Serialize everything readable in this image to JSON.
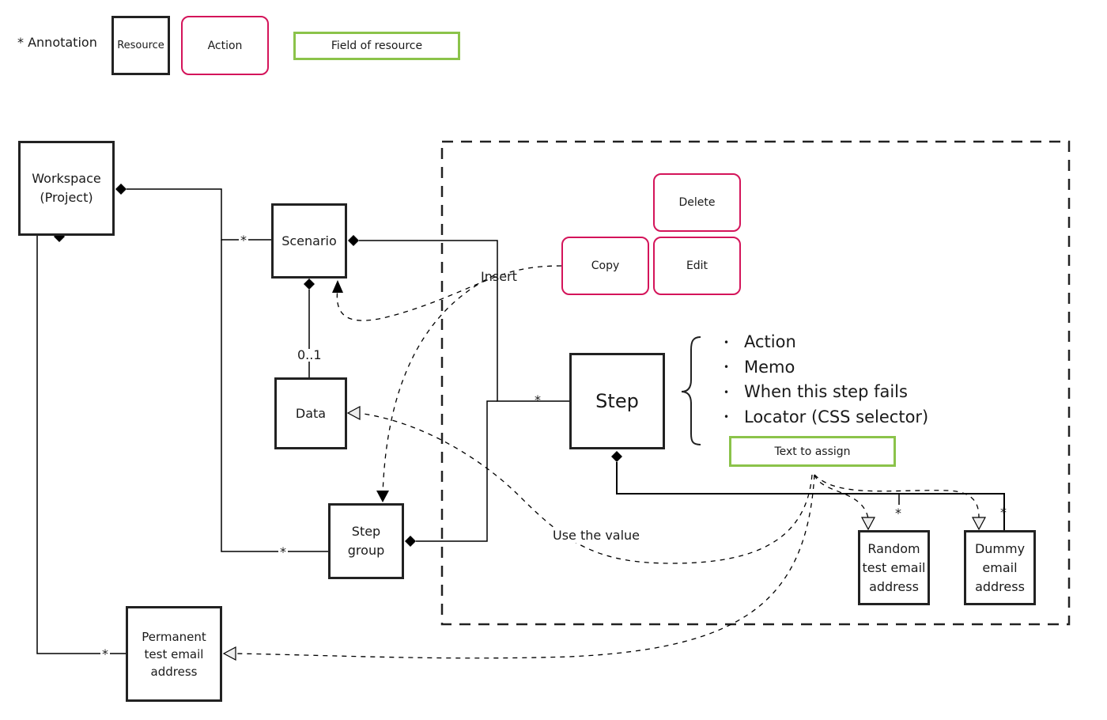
{
  "legend": {
    "annotation": "* Annotation",
    "resource": "Resource",
    "action": "Action",
    "field": "Field of resource"
  },
  "colors": {
    "resource_border": "#222222",
    "action_border": "#d4145a",
    "field_border": "#8bc34a"
  },
  "resources": {
    "workspace": "Workspace (Project)",
    "workspace_line1": "Workspace",
    "workspace_line2": "(Project)",
    "scenario": "Scenario",
    "data": "Data",
    "step_group_line1": "Step",
    "step_group_line2": "group",
    "step": "Step",
    "permanent_line1": "Permanent",
    "permanent_line2": "test email",
    "permanent_line3": "address",
    "random_line1": "Random",
    "random_line2": "test email",
    "random_line3": "address",
    "dummy_line1": "Dummy",
    "dummy_line2": "email",
    "dummy_line3": "address"
  },
  "actions": {
    "delete": "Delete",
    "copy": "Copy",
    "edit": "Edit"
  },
  "fields": {
    "text_to_assign": "Text to assign",
    "step_fields": [
      "Action",
      "Memo",
      "When this step fails",
      "Locator (CSS selector)"
    ]
  },
  "relations": {
    "insert_label": "Insert",
    "use_value_label": "Use the value",
    "many": "*",
    "zero_or_one": "0..1"
  }
}
